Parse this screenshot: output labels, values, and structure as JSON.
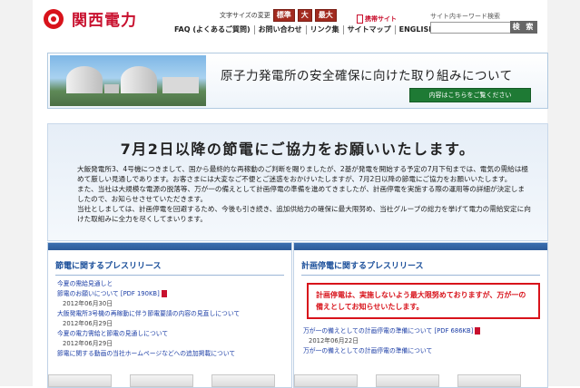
{
  "header": {
    "logo_text": "関西電力",
    "font_size_label": "文字サイズの変更",
    "font_sizes": [
      "標準",
      "大",
      "最大"
    ],
    "mobile_label": "携帯サイト",
    "nav": [
      "FAQ (よくあるご質問)",
      "お問い合わせ",
      "リンク集",
      "サイトマップ",
      "ENGLISH"
    ],
    "search_label": "サイト内キーワード検索",
    "search_value": "",
    "search_button": "検 索"
  },
  "banner": {
    "title": "原子力発電所の安全確保に向けた取り組みについて",
    "button": "内容はこちらをご覧ください"
  },
  "notice": {
    "title": "7月2日以降の節電にご協力をお願いいたします。",
    "paragraphs": [
      "大飯発電所3、4号機につきまして、国から最終的な再稼動のご判断を賜りましたが、2基が発電を開始する予定の7月下旬までは、電気の需給は極めて厳しい見通しであります。お客さまには大変なご不便とご迷惑をおかけいたしますが、7月2日以降の節電にご協力をお願いいたします。",
      "また、当社は大規模な電源の脱落等、万が一の備えとして計画停電の準備を進めてきましたが、計画停電を実施する際の運用等の詳細が決定しましたので、お知らせさせていただきます。",
      "当社としましては、計画停電を回避するため、今後も引き続き、追加供給力の確保に最大限努め、当社グループの総力を挙げて電力の需給安定に向けた取組みに全力を尽くしてまいります。"
    ]
  },
  "press_left": {
    "title": "節電に関するプレスリリース",
    "items": [
      {
        "link": "今夏の需給見通しと",
        "date": ""
      },
      {
        "link": "節電のお願いについて [PDF 190KB]",
        "date": "2012年06月30日"
      },
      {
        "link": "大飯発電所3号機の再稼動に伴う節電要請の内容の見直しについて",
        "date": "2012年06月29日"
      },
      {
        "link": "今夏の電力需給と節電の見通しについて",
        "date": "2012年06月29日"
      },
      {
        "link": "節電に関する動画の当社ホームページなどへの追加掲載について",
        "date": ""
      }
    ]
  },
  "press_right": {
    "title": "計画停電に関するプレスリリース",
    "warning": "計画停電は、実施しないよう最大限努めておりますが、万が一の備えとしてお知らせいたします。",
    "items": [
      {
        "link": "万が一の備えとしての計画停電の準備について [PDF 686KB]",
        "date": "2012年06月22日"
      },
      {
        "link": "万が一の備えとしての計画停電の準備について",
        "date": ""
      }
    ]
  }
}
